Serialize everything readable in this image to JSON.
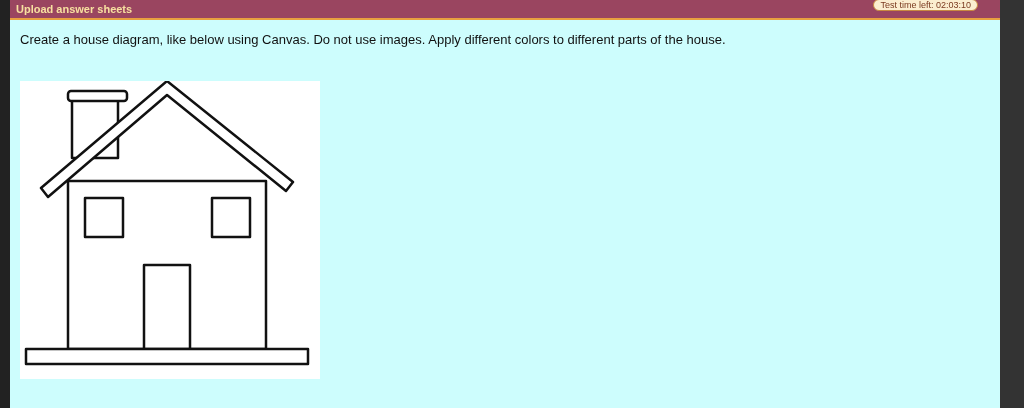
{
  "header": {
    "title": "Upload answer sheets",
    "timer": "Test time left: 02:03:10"
  },
  "question": {
    "text": "Create a house diagram, like below using Canvas. Do not use images. Apply different colors to different parts of the house."
  }
}
